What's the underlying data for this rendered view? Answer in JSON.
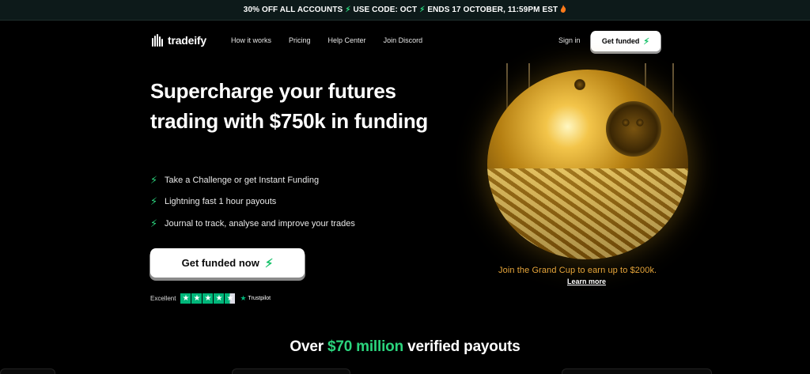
{
  "promo": {
    "part1": "30% OFF ALL ACCOUNTS",
    "part2": "USE CODE: OCT",
    "part3": "ENDS 17 OCTOBER, 11:59PM EST"
  },
  "nav": {
    "brand": "tradeify",
    "links": [
      "How it works",
      "Pricing",
      "Help Center",
      "Join Discord"
    ],
    "signin": "Sign in",
    "cta": "Get funded"
  },
  "hero": {
    "title": "Supercharge your futures trading with $750k in funding",
    "features": [
      "Take a Challenge or get Instant Funding",
      "Lightning fast 1 hour payouts",
      "Journal to track, analyse and improve your trades"
    ],
    "cta": "Get funded now",
    "rating_label": "Excellent",
    "rating_stars": 4.5,
    "rating_brand": "Trustpilot"
  },
  "promo_block": {
    "text": "Join the Grand Cup to earn up to $200k.",
    "link": "Learn more"
  },
  "payouts": {
    "prefix": "Over",
    "highlight": "$70 million",
    "suffix": "verified payouts"
  },
  "colors": {
    "accent": "#2bd47d",
    "gold": "#e6a53a",
    "background": "#000000",
    "trustpilot": "#00b67a"
  },
  "icons": [
    "lightning-bolt-icon",
    "fire-icon",
    "tradeify-logo-icon",
    "star-icon"
  ]
}
